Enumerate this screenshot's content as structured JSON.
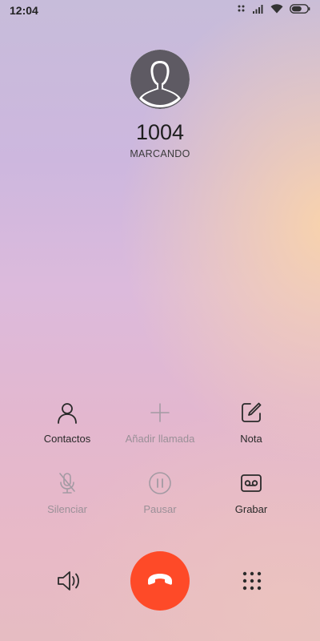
{
  "status_bar": {
    "time": "12:04",
    "icons": [
      "mute-icon",
      "signal-icon",
      "wifi-icon",
      "battery-icon"
    ]
  },
  "caller": {
    "number": "1004",
    "status": "MARCANDO"
  },
  "actions": {
    "contacts": {
      "label": "Contactos",
      "icon": "person-icon",
      "enabled": true
    },
    "add_call": {
      "label": "Añadir llamada",
      "icon": "plus-icon",
      "enabled": false
    },
    "note": {
      "label": "Nota",
      "icon": "note-edit-icon",
      "enabled": true
    },
    "mute": {
      "label": "Silenciar",
      "icon": "mic-off-icon",
      "enabled": false
    },
    "pause": {
      "label": "Pausar",
      "icon": "pause-icon",
      "enabled": false
    },
    "record": {
      "label": "Grabar",
      "icon": "record-icon",
      "enabled": true
    }
  },
  "bottom_bar": {
    "speaker_icon": "speaker-icon",
    "hangup_icon": "end-call-icon",
    "keypad_icon": "dialpad-icon"
  },
  "colors": {
    "hangup": "#fe4a28",
    "disabled": "#9a9098",
    "text": "#222222"
  }
}
